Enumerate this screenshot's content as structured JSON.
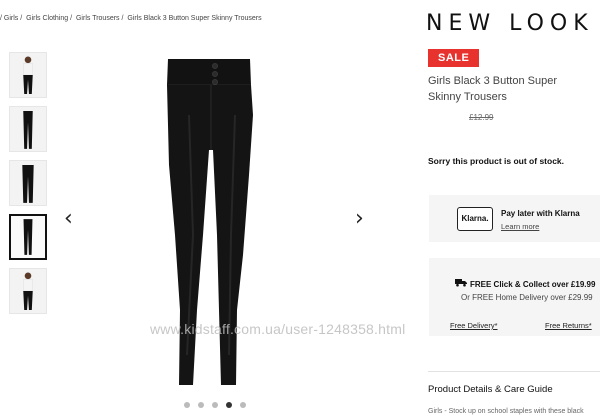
{
  "breadcrumb": {
    "items": [
      "/ Girls /",
      "Girls Clothing /",
      "Girls Trousers /",
      "Girls Black 3 Button Super Skinny Trousers"
    ]
  },
  "brand": {
    "logo_text": "NEW LOOK"
  },
  "product": {
    "badge": "SALE",
    "title": "Girls Black 3 Button Super Skinny Trousers",
    "old_price": "£12.99",
    "stock_message": "Sorry this product is out of stock."
  },
  "gallery": {
    "prev_arrow": "‹",
    "next_arrow": "›",
    "thumbnail_count": 5,
    "active_thumbnail": 4,
    "dot_count": 5,
    "active_dot": 4
  },
  "klarna": {
    "badge": "Klarna.",
    "title": "Pay later with Klarna",
    "link": "Learn more"
  },
  "delivery": {
    "collect": "FREE Click & Collect over £19.99",
    "home": "Or FREE Home Delivery over £29.99",
    "free_delivery_link": "Free Delivery*",
    "free_returns_link": "Free Returns*"
  },
  "details": {
    "heading": "Product Details & Care Guide",
    "snippet": "Girls - Stock up on school staples with these black"
  },
  "watermark": "www.kidstaff.com.ua/user-1248358.html",
  "colors": {
    "sale": "#e8322e",
    "panel": "#f5f5f5",
    "text": "#222222"
  }
}
